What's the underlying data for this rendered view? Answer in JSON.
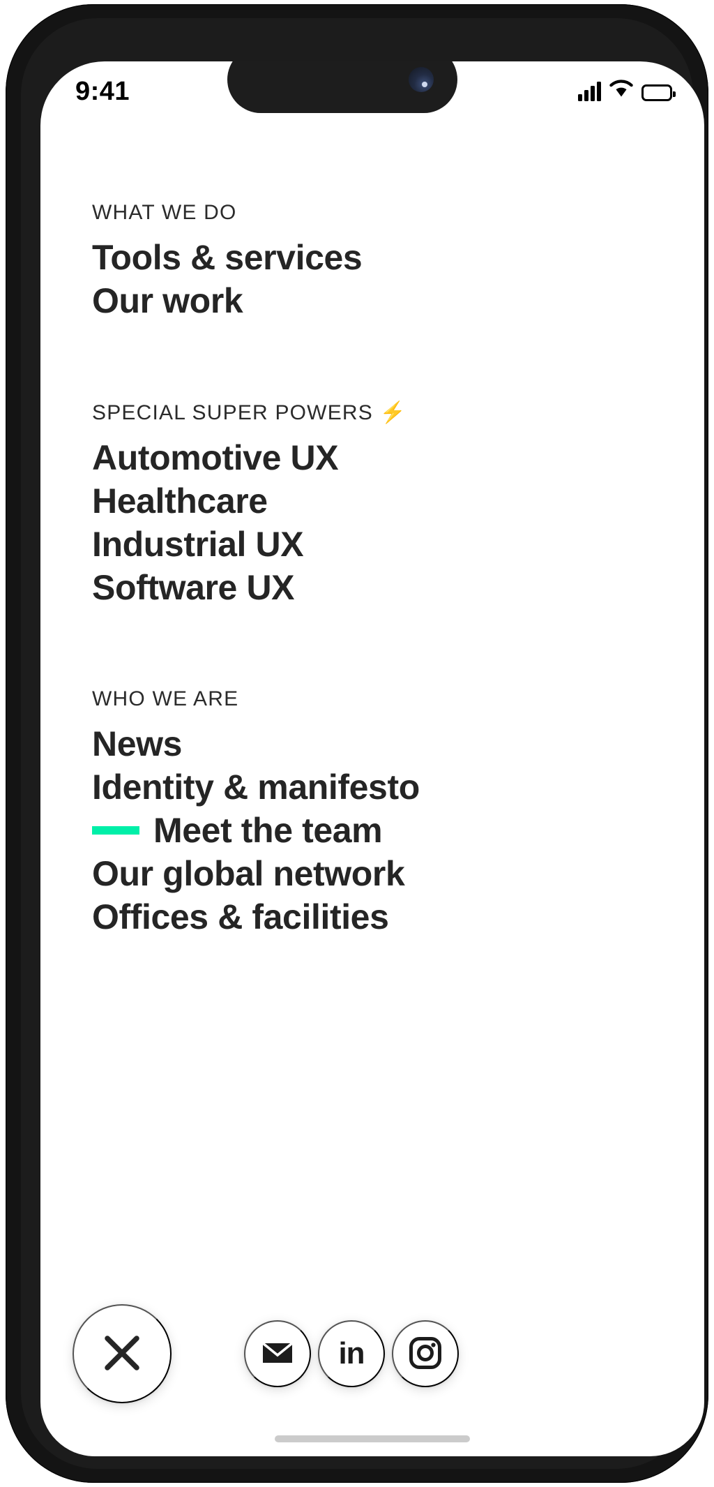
{
  "status_bar": {
    "time": "9:41",
    "signal_icon": "cellular-signal-icon",
    "wifi_icon": "wifi-icon",
    "battery_icon": "battery-icon"
  },
  "colors": {
    "accent_green": "#00EFA8",
    "text_dark": "#252525",
    "label_gray": "#2B2B2B",
    "frame_black": "#141414",
    "bolt_yellow": "#F7C843"
  },
  "nav_groups": [
    {
      "label": "WHAT WE DO",
      "emoji": "",
      "items": [
        {
          "label": "Tools & services",
          "active": false
        },
        {
          "label": "Our work",
          "active": false
        }
      ]
    },
    {
      "label": "SPECIAL SUPER POWERS",
      "emoji": "⚡",
      "items": [
        {
          "label": "Automotive UX",
          "active": false
        },
        {
          "label": "Healthcare",
          "active": false
        },
        {
          "label": "Industrial UX",
          "active": false
        },
        {
          "label": "Software UX",
          "active": false
        }
      ]
    },
    {
      "label": "WHO WE ARE",
      "emoji": "",
      "items": [
        {
          "label": "News",
          "active": false
        },
        {
          "label": "Identity & manifesto",
          "active": false
        },
        {
          "label": "Meet the team",
          "active": true
        },
        {
          "label": "Our global network",
          "active": false
        },
        {
          "label": "Offices & facilities",
          "active": false
        }
      ]
    }
  ],
  "action_row": {
    "close": {
      "label": "Close menu",
      "icon": "close-x-icon"
    },
    "social": [
      {
        "label": "Email",
        "icon": "envelope-icon"
      },
      {
        "label": "LinkedIn",
        "icon": "linkedin-icon",
        "text": "in"
      },
      {
        "label": "Instagram",
        "icon": "instagram-icon"
      }
    ]
  }
}
